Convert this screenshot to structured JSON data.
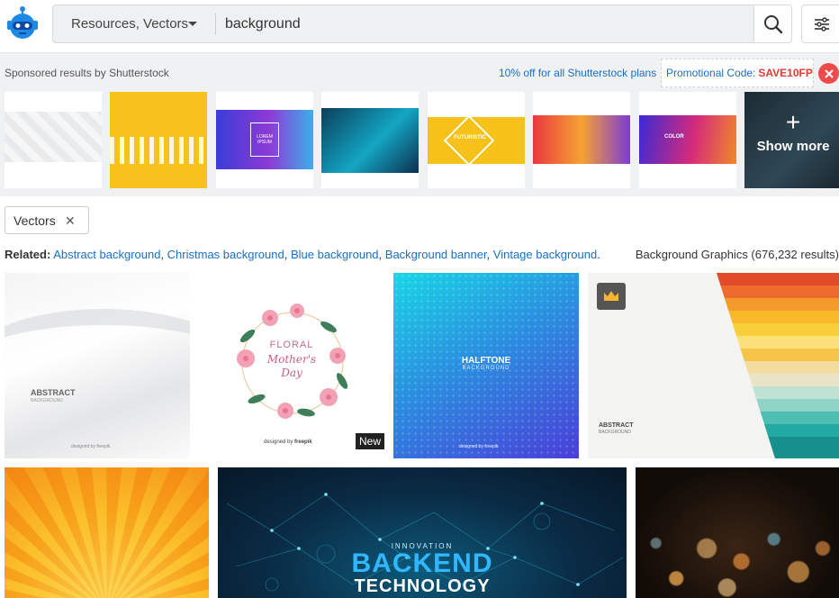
{
  "header": {
    "resource_type": "Resources, Vectors",
    "search_value": "background"
  },
  "sponsored": {
    "label": "Sponsored results by Shutterstock",
    "promo_text": "10% off for all Shutterstock plans",
    "promo_code_label": "Promotional Code:",
    "promo_code": "SAVE10FP",
    "show_more": "Show more",
    "thumbnail_texts": [
      "LOREM IPSUM",
      "FUTURISTIC",
      "COLOR"
    ]
  },
  "filter_chip": {
    "label": "Vectors"
  },
  "related": {
    "label": "Related:",
    "links": [
      "Abstract background",
      "Christmas background",
      "Blue background",
      "Background banner",
      "Vintage background"
    ]
  },
  "results_title": "Background Graphics (676,232 results)",
  "cards": {
    "abstract_title": "ABSTRACT",
    "abstract_sub": "BACKGROUND",
    "designed_by": "designed by",
    "brand": "freepik",
    "floral_line1": "FLORAL",
    "floral_line2": "Mother's",
    "floral_line3": "Day",
    "new_badge": "New",
    "halftone_title": "HALFTONE",
    "halftone_sub": "BACKGROUND",
    "stripes_title": "ABSTRACT",
    "stripes_sub": "BACKGROUND",
    "tech_kicker": "INNOVATION",
    "tech_title": "BACKEND",
    "tech_sub": "TECHNOLOGY"
  },
  "colors": {
    "accent": "#1a6fc6",
    "promo_code": "#e53935",
    "close": "#ef4a4a"
  }
}
